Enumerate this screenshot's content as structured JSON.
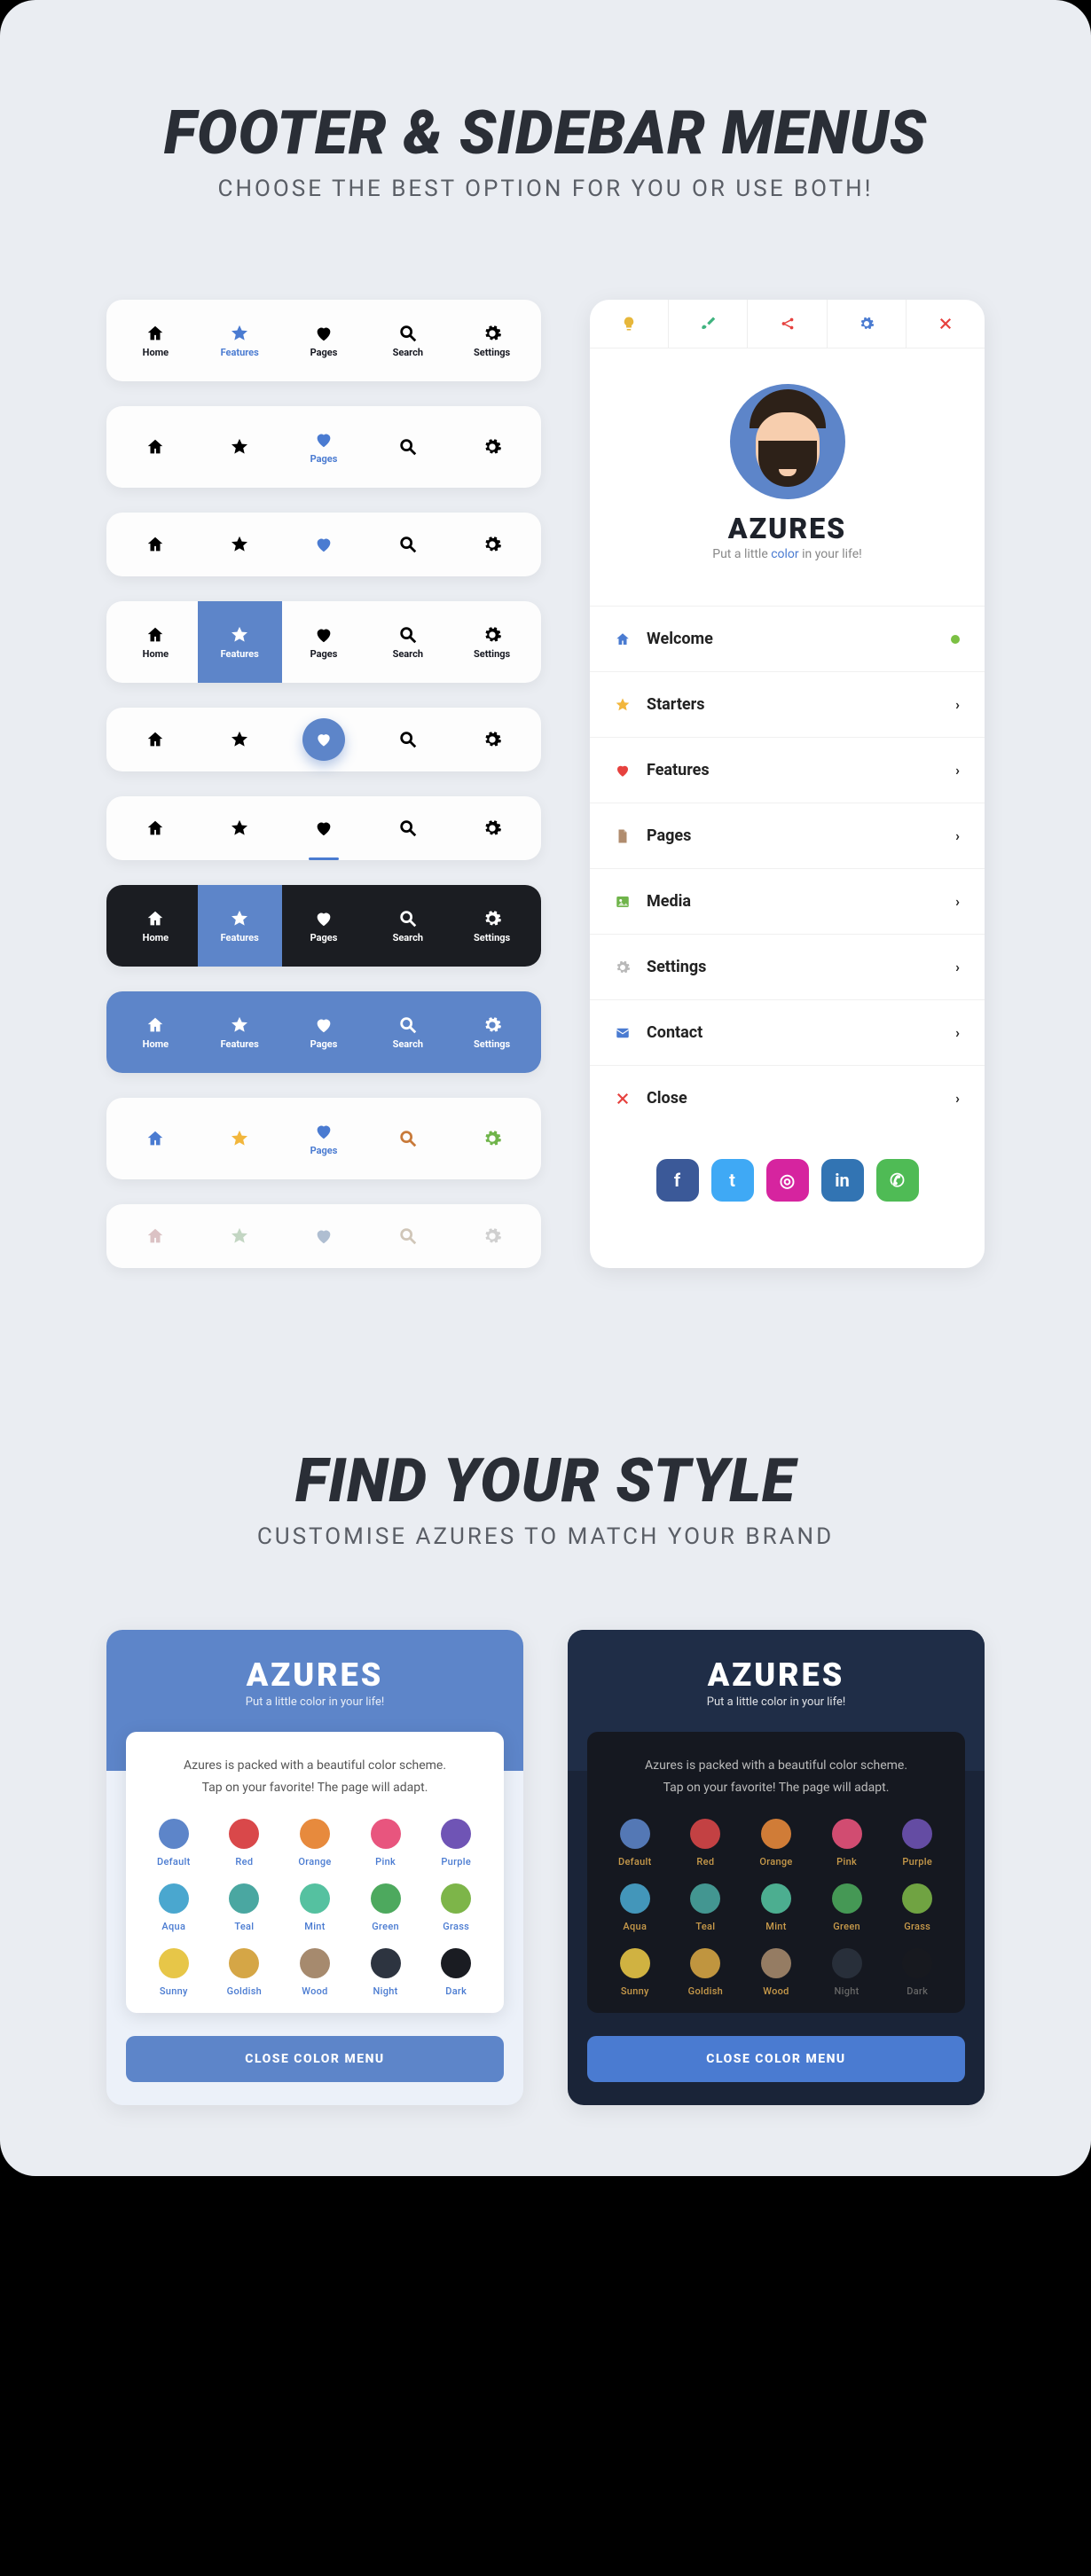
{
  "section1": {
    "title": "FOOTER & SIDEBAR MENUS",
    "sub": "CHOOSE THE BEST OPTION FOR YOU OR USE BOTH!"
  },
  "footer_items": [
    {
      "icon": "home",
      "label": "Home"
    },
    {
      "icon": "star",
      "label": "Features"
    },
    {
      "icon": "heart",
      "label": "Pages"
    },
    {
      "icon": "search",
      "label": "Search"
    },
    {
      "icon": "gear",
      "label": "Settings"
    }
  ],
  "sidebar": {
    "top_icons": [
      "bulb",
      "brush",
      "share",
      "gear",
      "close"
    ],
    "top_colors": [
      "#e7b73b",
      "#3fb37f",
      "#e6413e",
      "#4a7bd1",
      "#e6413e"
    ],
    "brand": "AZURES",
    "tag_pre": "Put a little ",
    "tag_color": "color",
    "tag_post": " in your life!",
    "items": [
      {
        "icon": "home",
        "label": "Welcome",
        "color": "#4a7bd1",
        "badge": "dot"
      },
      {
        "icon": "star",
        "label": "Starters",
        "color": "#f2b63c"
      },
      {
        "icon": "heart",
        "label": "Features",
        "color": "#e6413e"
      },
      {
        "icon": "file",
        "label": "Pages",
        "color": "#b08c6e"
      },
      {
        "icon": "image",
        "label": "Media",
        "color": "#6fb44a"
      },
      {
        "icon": "gear",
        "label": "Settings",
        "color": "#b8b8b8"
      },
      {
        "icon": "mail",
        "label": "Contact",
        "color": "#4a7bd1"
      },
      {
        "icon": "close",
        "label": "Close",
        "color": "#e6413e"
      }
    ],
    "socials": [
      {
        "name": "facebook",
        "glyph": "f",
        "bg": "#3b5998"
      },
      {
        "name": "twitter",
        "glyph": "t",
        "bg": "#3fa9f5"
      },
      {
        "name": "instagram",
        "glyph": "◎",
        "bg": "#d6249f"
      },
      {
        "name": "linkedin",
        "glyph": "in",
        "bg": "#3274b3"
      },
      {
        "name": "whatsapp",
        "glyph": "✆",
        "bg": "#4fbb55"
      }
    ]
  },
  "section2": {
    "title": "FIND YOUR STYLE",
    "sub": "CUSTOMISE AZURES TO MATCH YOUR BRAND"
  },
  "color_card": {
    "brand": "AZURES",
    "tag": "Put a little color in your life!",
    "desc1": "Azures is packed with a beautiful color scheme.",
    "desc2": "Tap on your favorite! The page will adapt.",
    "close": "CLOSE COLOR MENU",
    "swatches": [
      {
        "name": "Default",
        "hex": "#5d85c9"
      },
      {
        "name": "Red",
        "hex": "#d9484a"
      },
      {
        "name": "Orange",
        "hex": "#e78a3d"
      },
      {
        "name": "Pink",
        "hex": "#e8557e"
      },
      {
        "name": "Purple",
        "hex": "#6f54b5"
      },
      {
        "name": "Aqua",
        "hex": "#4aa7cf"
      },
      {
        "name": "Teal",
        "hex": "#4aa7a1"
      },
      {
        "name": "Mint",
        "hex": "#55c1a0"
      },
      {
        "name": "Green",
        "hex": "#4da95e"
      },
      {
        "name": "Grass",
        "hex": "#7db549"
      },
      {
        "name": "Sunny",
        "hex": "#e7c648"
      },
      {
        "name": "Goldish",
        "hex": "#d5a646"
      },
      {
        "name": "Wood",
        "hex": "#a68a6e"
      },
      {
        "name": "Night",
        "hex": "#2d3440"
      },
      {
        "name": "Dark",
        "hex": "#1a1c22"
      }
    ]
  }
}
